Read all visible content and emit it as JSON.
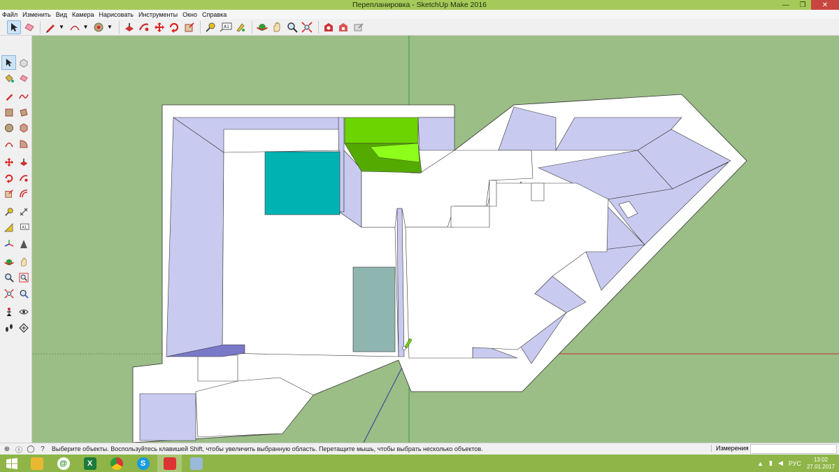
{
  "window": {
    "title": "Перепланировка - SketchUp Make 2016",
    "minimize": "—",
    "maximize": "❐",
    "close": "✕"
  },
  "menu": [
    "Файл",
    "Изменить",
    "Вид",
    "Камера",
    "Нарисовать",
    "Инструменты",
    "Окно",
    "Справка"
  ],
  "toolbar": {
    "icons": [
      "select-icon",
      "eraser-icon",
      "pencil-icon",
      "arc-icon",
      "paint-bucket-icon",
      "push-pull-icon",
      "follow-me-icon",
      "move-icon",
      "rotate-icon",
      "scale-icon",
      "tape-measure-icon",
      "text-icon",
      "orbit-icon",
      "pan-icon",
      "zoom-icon",
      "zoom-extents-icon",
      "warehouse-icon",
      "extension-icon",
      "share-icon"
    ]
  },
  "palette": {
    "icons": [
      [
        "select-icon",
        "component-icon"
      ],
      [
        "paint-bucket-icon",
        "eraser-icon"
      ],
      [
        "line-icon",
        "freehand-icon"
      ],
      [
        "rectangle-icon",
        "rotated-rectangle-icon"
      ],
      [
        "circle-icon",
        "polygon-icon"
      ],
      [
        "arc-icon",
        "pie-icon"
      ],
      [
        "move-icon",
        "push-pull-icon"
      ],
      [
        "rotate-icon",
        "follow-me-icon"
      ],
      [
        "scale-icon",
        "offset-icon"
      ],
      [
        "tape-measure-icon",
        "dimension-icon"
      ],
      [
        "protractor-icon",
        "text-icon"
      ],
      [
        "axes-icon",
        "3d-text-icon"
      ],
      [
        "orbit-icon",
        "pan-icon"
      ],
      [
        "zoom-icon",
        "zoom-window-icon"
      ],
      [
        "zoom-extents-icon",
        "previous-view-icon"
      ],
      [
        "position-camera-icon",
        "look-around-icon"
      ],
      [
        "walk-icon",
        "section-plane-icon"
      ]
    ]
  },
  "status": {
    "hint": "Выберите объекты. Воспользуйтесь клавишей Shift, чтобы увеличить выбранную область. Перетащите мышь, чтобы выбрать несколько объектов.",
    "measurements_label": "Измерения",
    "measurements_value": ""
  },
  "taskbar": {
    "apps": [
      "windows-start-icon",
      "file-explorer-icon",
      "mail-agent-icon",
      "excel-icon",
      "chrome-icon",
      "skype-icon",
      "sketchup-icon",
      "paint-icon"
    ],
    "lang": "РУС",
    "time": "13:02",
    "date": "27.01.2017"
  },
  "colors": {
    "titlebar": "#a6ca5a",
    "viewport_bg": "#9bbd86",
    "wall_shade": "#c9caf0",
    "floor": "#ffffff",
    "green_box": "#6cd400",
    "teal_rect": "#00b3b3",
    "gray_teal_rect": "#8fb5b0",
    "purple_bar": "#7a78c8"
  }
}
